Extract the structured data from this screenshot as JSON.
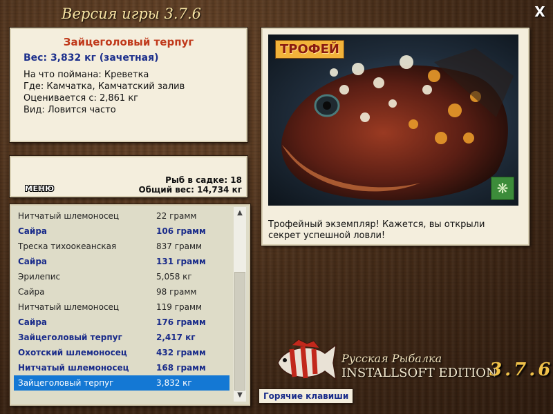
{
  "window": {
    "title": "Версия игры 3.7.6",
    "close_label": "X"
  },
  "info": {
    "fish_name": "Зайцеголовый терпуг",
    "weight": "Вес: 3,832 кг (зачетная)",
    "bait": "На что поймана: Креветка",
    "location": "Где: Камчатка, Камчатский залив",
    "rated_from": "Оценивается с: 2,861 кг",
    "kind": "Вид: Ловится часто"
  },
  "cage": {
    "menu_label": "МЕНЮ",
    "count": "Рыб в садке: 18",
    "total_weight": "Общий вес: 14,734 кг"
  },
  "catch_list": [
    {
      "name": "Нитчатый шлемоносец",
      "weight": "22 грамм",
      "style": "normal"
    },
    {
      "name": "Сайра",
      "weight": "106 грамм",
      "style": "bold"
    },
    {
      "name": "Треска тихоокеанская",
      "weight": "837 грамм",
      "style": "normal"
    },
    {
      "name": "Сайра",
      "weight": "131 грамм",
      "style": "bold"
    },
    {
      "name": "Эрилепис",
      "weight": "5,058 кг",
      "style": "normal"
    },
    {
      "name": "Сайра",
      "weight": "98 грамм",
      "style": "normal"
    },
    {
      "name": "Нитчатый шлемоносец",
      "weight": "119 грамм",
      "style": "normal"
    },
    {
      "name": "Сайра",
      "weight": "176 грамм",
      "style": "bold"
    },
    {
      "name": "Зайцеголовый терпуг",
      "weight": "2,417 кг",
      "style": "bold"
    },
    {
      "name": "Охотский шлемоносец",
      "weight": "432 грамм",
      "style": "bold"
    },
    {
      "name": "Нитчатый шлемоносец",
      "weight": "168 грамм",
      "style": "bold"
    },
    {
      "name": "Зайцеголовый терпуг",
      "weight": "3,832 кг",
      "style": "selected"
    }
  ],
  "photo": {
    "badge": "ТРОФЕЙ",
    "caption": "Трофейный экземпляр! Кажется, вы открыли секрет успешной ловли!"
  },
  "logo": {
    "line1": "Русская Рыбалка",
    "line2": "INSTALLSOFT EDITION",
    "version": "3.7.6"
  },
  "hotkeys_label": "Горячие клавиши",
  "icons": {
    "close": "close-icon",
    "scroll_up": "chevron-up-icon",
    "scroll_down": "chevron-down-icon",
    "fly": "butterfly-icon",
    "logo": "fish-logo-icon"
  }
}
